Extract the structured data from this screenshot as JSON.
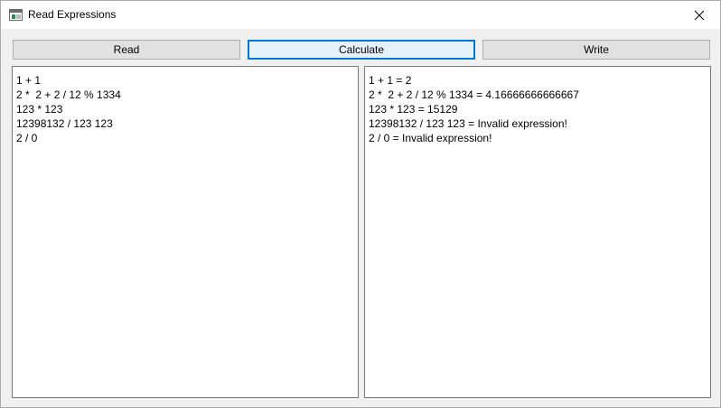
{
  "window": {
    "title": "Read Expressions"
  },
  "toolbar": {
    "read_label": "Read",
    "calculate_label": "Calculate",
    "write_label": "Write"
  },
  "input": {
    "lines": [
      "1 + 1",
      "2 *  2 + 2 / 12 % 1334",
      "123 * 123",
      "12398132 / 123 123",
      "2 / 0"
    ]
  },
  "output": {
    "lines": [
      "1 + 1 = 2",
      "2 *  2 + 2 / 12 % 1334 = 4.16666666666667",
      "123 * 123 = 15129",
      "12398132 / 123 123 = Invalid expression!",
      "2 / 0 = Invalid expression!"
    ]
  },
  "colors": {
    "focus_accent": "#0078d7",
    "button_face": "#e1e1e1",
    "window_bg": "#f0f0f0"
  }
}
